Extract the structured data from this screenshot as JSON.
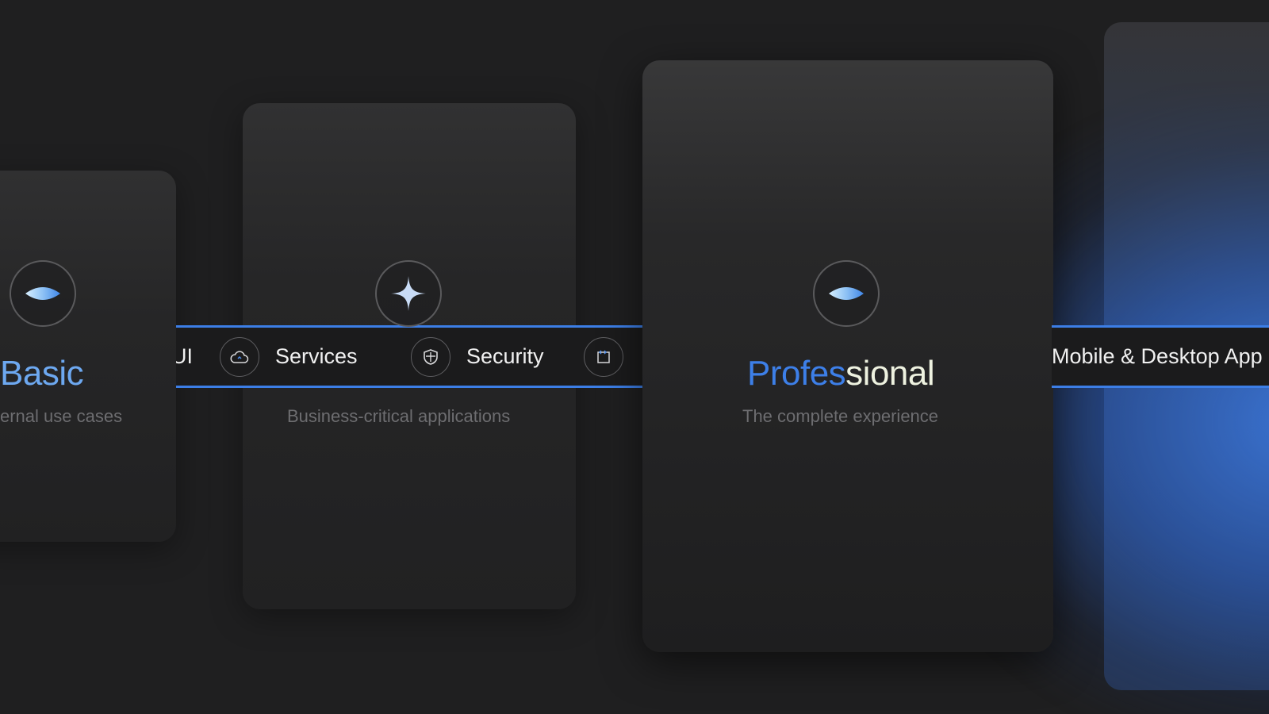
{
  "cards": {
    "basic": {
      "title": "Basic",
      "subtitle": "ernal use cases",
      "icon": "eye-icon"
    },
    "middle": {
      "subtitle": "Business-critical applications",
      "icon": "sparkle-icon"
    },
    "professional": {
      "title_part1": "Profes",
      "title_part2": "sional",
      "subtitle": "The complete experience",
      "icon": "eye-icon"
    }
  },
  "band_left": {
    "items": [
      {
        "label": "UI",
        "icon": ""
      },
      {
        "label": "Services",
        "icon": "cloud-icon"
      },
      {
        "label": "Security",
        "icon": "shield-icon"
      },
      {
        "label": "",
        "icon": "code-window-icon"
      }
    ]
  },
  "band_right": {
    "items": [
      {
        "label": "Mobile & Desktop App"
      }
    ]
  },
  "colors": {
    "accent": "#3c7ee6",
    "background": "#1f1f20",
    "title_gradient_start": "#3d7fe8",
    "title_gradient_end": "#eef2e0"
  }
}
